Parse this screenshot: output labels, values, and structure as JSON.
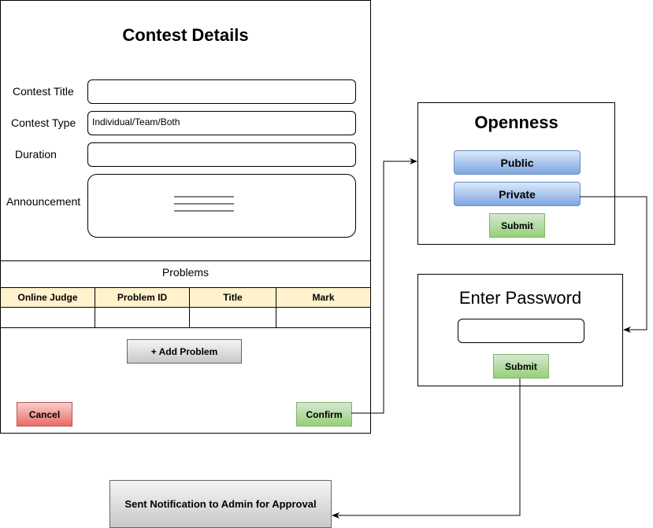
{
  "contest_form": {
    "title": "Contest Details",
    "fields": {
      "contest_title": {
        "label": "Contest Title",
        "value": ""
      },
      "contest_type": {
        "label": "Contest Type",
        "value": "Individual/Team/Both"
      },
      "duration": {
        "label": "Duration",
        "value": ""
      },
      "announcement": {
        "label": "Announcement"
      }
    },
    "problems": {
      "heading": "Problems",
      "columns": [
        "Online Judge",
        "Problem ID",
        "Title",
        "Mark"
      ],
      "add_label": "+ Add Problem"
    },
    "cancel_label": "Cancel",
    "confirm_label": "Confirm"
  },
  "openness": {
    "title": "Openness",
    "options": [
      "Public",
      "Private"
    ],
    "submit_label": "Submit"
  },
  "password": {
    "title": "Enter Password",
    "submit_label": "Submit"
  },
  "notification": {
    "label": "Sent Notification to Admin for Approval"
  },
  "colors": {
    "header_fill": "#fff2cc",
    "cancel": "#ea6b66",
    "confirm": "#97d077",
    "option": "#7ea6e0"
  }
}
